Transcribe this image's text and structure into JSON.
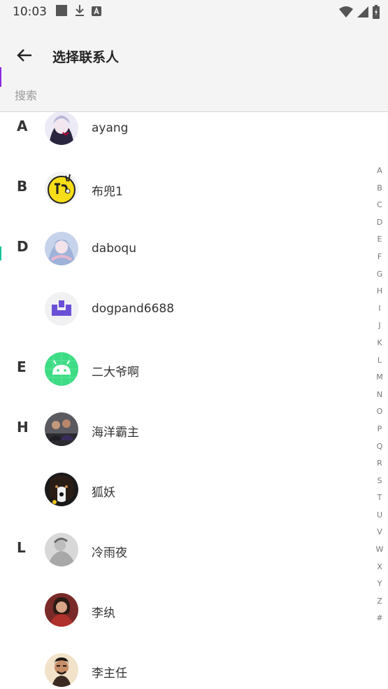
{
  "status_bar": {
    "time": "10:03",
    "left_icons": [
      "square-notification-icon",
      "download-icon",
      "a-letter-icon"
    ],
    "right_icons": [
      "wifi-icon",
      "signal-icon",
      "battery-icon"
    ]
  },
  "header": {
    "back_icon": "arrow-left-icon",
    "title": "选择联系人"
  },
  "search": {
    "placeholder": "搜索",
    "value": ""
  },
  "contacts": [
    {
      "section": "A",
      "name": "ayang",
      "avatar": "anime-avatar"
    },
    {
      "section": "B",
      "name": "布兜1",
      "avatar": "yellow-emoji-avatar"
    },
    {
      "section": "D",
      "name": "daboqu",
      "avatar": "anime-girl-avatar"
    },
    {
      "section": "",
      "name": "dogpand6688",
      "avatar": "purple-logo-avatar"
    },
    {
      "section": "E",
      "name": "二大爷啊",
      "avatar": "android-avatar"
    },
    {
      "section": "H",
      "name": "海洋霸主",
      "avatar": "group-photo-avatar"
    },
    {
      "section": "",
      "name": "狐妖",
      "avatar": "dog-avatar"
    },
    {
      "section": "L",
      "name": "冷雨夜",
      "avatar": "grayscale-avatar"
    },
    {
      "section": "",
      "name": "李纨",
      "avatar": "woman-photo-avatar"
    },
    {
      "section": "",
      "name": "李主任",
      "avatar": "man-photo-avatar"
    }
  ],
  "index_letters": [
    "A",
    "B",
    "C",
    "D",
    "E",
    "F",
    "G",
    "H",
    "I",
    "J",
    "K",
    "L",
    "M",
    "N",
    "O",
    "P",
    "Q",
    "R",
    "S",
    "T",
    "U",
    "V",
    "W",
    "X",
    "Y",
    "Z",
    "#"
  ],
  "colors": {
    "bar_background": "#f4f4f4",
    "android_green": "#3ddc84",
    "logo_purple": "#6b4fd8"
  }
}
